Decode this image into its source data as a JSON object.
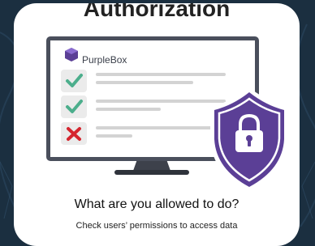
{
  "header": {
    "title": "Authorization"
  },
  "monitor": {
    "brand_name": "PurpleBox",
    "brand_logo": "purplebox-cube-logo",
    "checklist": [
      {
        "status": "check-icon",
        "color": "#4cae8c"
      },
      {
        "status": "check-icon",
        "color": "#4cae8c"
      },
      {
        "status": "cross-icon",
        "color": "#d5262f"
      }
    ]
  },
  "shield": {
    "icon": "lock-shield-icon",
    "color": "#5b3f96"
  },
  "footer": {
    "question": "What are you allowed to do?",
    "subtitle": "Check users’ permissions to access data"
  },
  "colors": {
    "background": "#1b2f40",
    "card": "#ffffff",
    "monitor_frame": "#4a4f5c",
    "accent_purple": "#5b3f96"
  }
}
